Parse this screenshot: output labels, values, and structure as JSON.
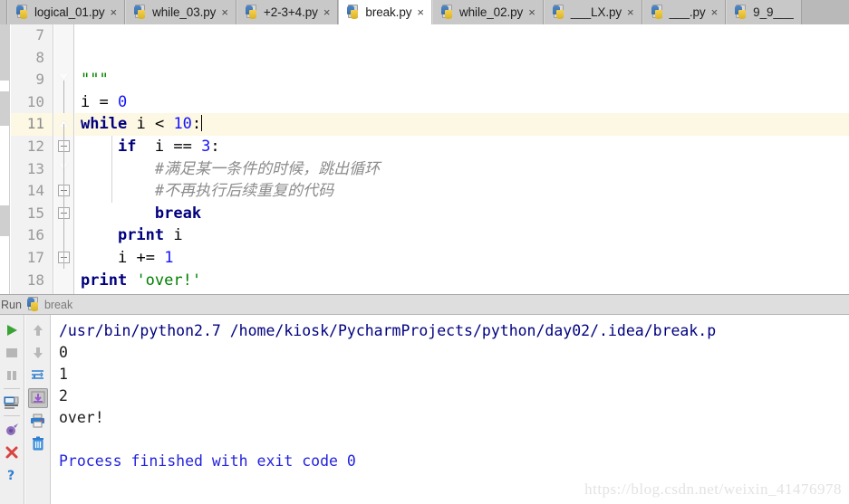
{
  "window": {
    "ide": "PyCharm",
    "watermark": "https://blog.csdn.net/weixin_41476978"
  },
  "tabs": [
    {
      "label": "logical_01.py",
      "icon": "python-file-icon",
      "close": "×",
      "active": false
    },
    {
      "label": "while_03.py",
      "icon": "python-file-icon",
      "close": "×",
      "active": false
    },
    {
      "label": "+2-3+4.py",
      "icon": "python-file-icon",
      "close": "×",
      "active": false
    },
    {
      "label": "break.py",
      "icon": "python-file-icon",
      "close": "×",
      "active": true
    },
    {
      "label": "while_02.py",
      "icon": "python-file-icon",
      "close": "×",
      "active": false
    },
    {
      "label": "___LX.py",
      "icon": "python-file-icon",
      "close": "×",
      "active": false
    },
    {
      "label": "___.py",
      "icon": "python-file-icon",
      "close": "×",
      "active": false
    },
    {
      "label": "9_9___",
      "icon": "python-file-icon",
      "close": "",
      "active": false
    }
  ],
  "editor": {
    "language": "python",
    "current_line": 11,
    "first_visible_line": 7,
    "lines": [
      {
        "number": "7",
        "text": ""
      },
      {
        "number": "8",
        "text": ""
      },
      {
        "number": "9",
        "text": "\"\"\""
      },
      {
        "number": "10",
        "text": "i = 0"
      },
      {
        "number": "11",
        "text": "while i < 10:"
      },
      {
        "number": "12",
        "text": "    if  i == 3:"
      },
      {
        "number": "13",
        "text": "        #满足某一条件的时候，跳出循环"
      },
      {
        "number": "14",
        "text": "        #不再执行后续重复的代码"
      },
      {
        "number": "15",
        "text": "        break"
      },
      {
        "number": "16",
        "text": "    print i"
      },
      {
        "number": "17",
        "text": "    i += 1"
      },
      {
        "number": "18",
        "text": "print 'over!'"
      }
    ],
    "tokens": {
      "docstring": "\"\"\"",
      "var_i": "i",
      "assign": "=",
      "zero": "0",
      "while": "while",
      "lt": "<",
      "ten": "10",
      "colon": ":",
      "if": "if",
      "eqeq": "==",
      "three": "3",
      "comment1": "#满足某一条件的时候，跳出循环",
      "comment2": "#不再执行后续重复的代码",
      "break": "break",
      "print": "print",
      "pluseq": "+=",
      "one": "1",
      "over_string": "'over!'"
    },
    "colors": {
      "keyword": "#00007f",
      "number": "#1414ff",
      "string": "#008000",
      "comment": "#8c8c8c",
      "current_line_bg": "#fcf8e3",
      "gutter_bg": "#f2f2f2",
      "line_number": "#9a9a9a"
    }
  },
  "run_panel": {
    "title": "Run",
    "tab_label": "break",
    "tab_icon": "python-file-icon",
    "toolbar_left": [
      {
        "name": "rerun-button",
        "icon": "play-icon",
        "selected": false
      },
      {
        "name": "stop-button",
        "icon": "stop-square-icon",
        "selected": false
      },
      {
        "name": "pause-button",
        "icon": "pause-icon",
        "selected": false
      },
      {
        "name": "show-console-button",
        "icon": "console-icon",
        "selected": false
      },
      {
        "name": "mute-breakpoints-button",
        "icon": "breakpoint-mute-icon",
        "selected": false
      },
      {
        "name": "close-button",
        "icon": "close-x-icon",
        "selected": false
      },
      {
        "name": "help-button",
        "icon": "question-mark-icon",
        "selected": false
      }
    ],
    "toolbar_right": [
      {
        "name": "up-button",
        "icon": "arrow-up-icon",
        "selected": false
      },
      {
        "name": "down-button",
        "icon": "arrow-down-icon",
        "selected": false
      },
      {
        "name": "soft-wrap-button",
        "icon": "soft-wrap-icon",
        "selected": false
      },
      {
        "name": "scroll-to-end-button",
        "icon": "scroll-to-end-icon",
        "selected": true
      },
      {
        "name": "print-button",
        "icon": "printer-icon",
        "selected": false
      },
      {
        "name": "clear-all-button",
        "icon": "trash-icon",
        "selected": false
      }
    ],
    "console": [
      {
        "text": "/usr/bin/python2.7 /home/kiosk/PycharmProjects/python/day02/.idea/break.p",
        "kind": "cmd"
      },
      {
        "text": "0",
        "kind": "out"
      },
      {
        "text": "1",
        "kind": "out"
      },
      {
        "text": "2",
        "kind": "out"
      },
      {
        "text": "over!",
        "kind": "out"
      },
      {
        "text": " ",
        "kind": "blank"
      },
      {
        "text": "Process finished with exit code 0",
        "kind": "finish"
      }
    ]
  }
}
